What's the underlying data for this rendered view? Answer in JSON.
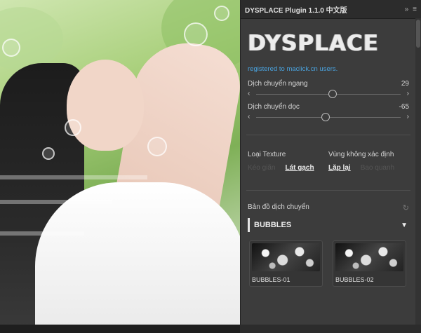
{
  "panel": {
    "title": "DYSPLACE Plugin 1.1.0 中文版",
    "controls": {
      "collapse": "»",
      "menu": "≡"
    },
    "logo_text": "DYSPLACE",
    "registered_text": "registered to maclick.cn users.",
    "sliders": [
      {
        "label": "Dịch chuyển ngang",
        "value": "29",
        "position": 0.53
      },
      {
        "label": "Dịch chuyển dọc",
        "value": "-65",
        "position": 0.48
      }
    ],
    "texture": {
      "label": "Loại Texture",
      "options": [
        "Kéo giãn",
        "Lát gạch"
      ],
      "active_index": 1
    },
    "undefined_area": {
      "label": "Vùng không xác định",
      "options": [
        "Lặp lại",
        "Bao quanh"
      ],
      "active_index": 0
    },
    "map": {
      "label": "Bản đồ dịch chuyển",
      "selected": "BUBBLES",
      "caret": "▼",
      "thumbnails": [
        "BUBBLES-01",
        "BUBBLES-02"
      ]
    },
    "colors": {
      "background": "#3c3c3c",
      "accent": "#4aa3df",
      "title_bg": "#2c2c2c"
    }
  }
}
